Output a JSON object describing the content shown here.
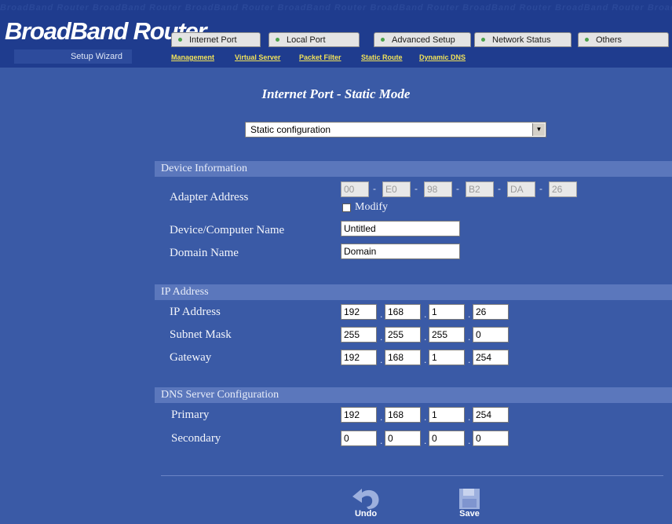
{
  "header": {
    "watermark": "BroadBand Router  BroadBand Router  BroadBand Router  BroadBand Router  BroadBand Router  BroadBand Router  BroadBand Router  BroadBand Router  BroadBand Router",
    "brand": "BroadBand Router",
    "setup_wizard": "Setup Wizard",
    "tabs": [
      "Internet Port",
      "Local Port",
      "Advanced Setup",
      "Network Status",
      "Others"
    ],
    "sublinks": [
      "Management",
      "Virtual Server",
      "Packet Filter",
      "Static Route",
      "Dynamic DNS"
    ]
  },
  "page": {
    "title": "Internet Port - Static Mode",
    "mode_select": "Static configuration"
  },
  "device": {
    "section": "Device Information",
    "adapter_label": "Adapter Address",
    "mac": [
      "00",
      "E0",
      "98",
      "B2",
      "DA",
      "26"
    ],
    "mac_sep": "-",
    "modify_label": "Modify",
    "name_label": "Device/Computer Name",
    "name_value": "Untitled",
    "domain_label": "Domain Name",
    "domain_value": "Domain"
  },
  "ip": {
    "section": "IP Address",
    "dot": ".",
    "ip_label": "IP Address",
    "ip": [
      "192",
      "168",
      "1",
      "26"
    ],
    "mask_label": "Subnet Mask",
    "mask": [
      "255",
      "255",
      "255",
      "0"
    ],
    "gw_label": "Gateway",
    "gw": [
      "192",
      "168",
      "1",
      "254"
    ]
  },
  "dns": {
    "section": "DNS Server Configuration",
    "primary_label": "Primary",
    "primary": [
      "192",
      "168",
      "1",
      "254"
    ],
    "secondary_label": "Secondary",
    "secondary": [
      "0",
      "0",
      "0",
      "0"
    ]
  },
  "actions": {
    "undo": "Undo",
    "save": "Save"
  },
  "colors": {
    "background": "#3a5aa6",
    "header": "#1f3c8e",
    "section_bar": "#5b77bc",
    "link": "#f2e35a"
  }
}
